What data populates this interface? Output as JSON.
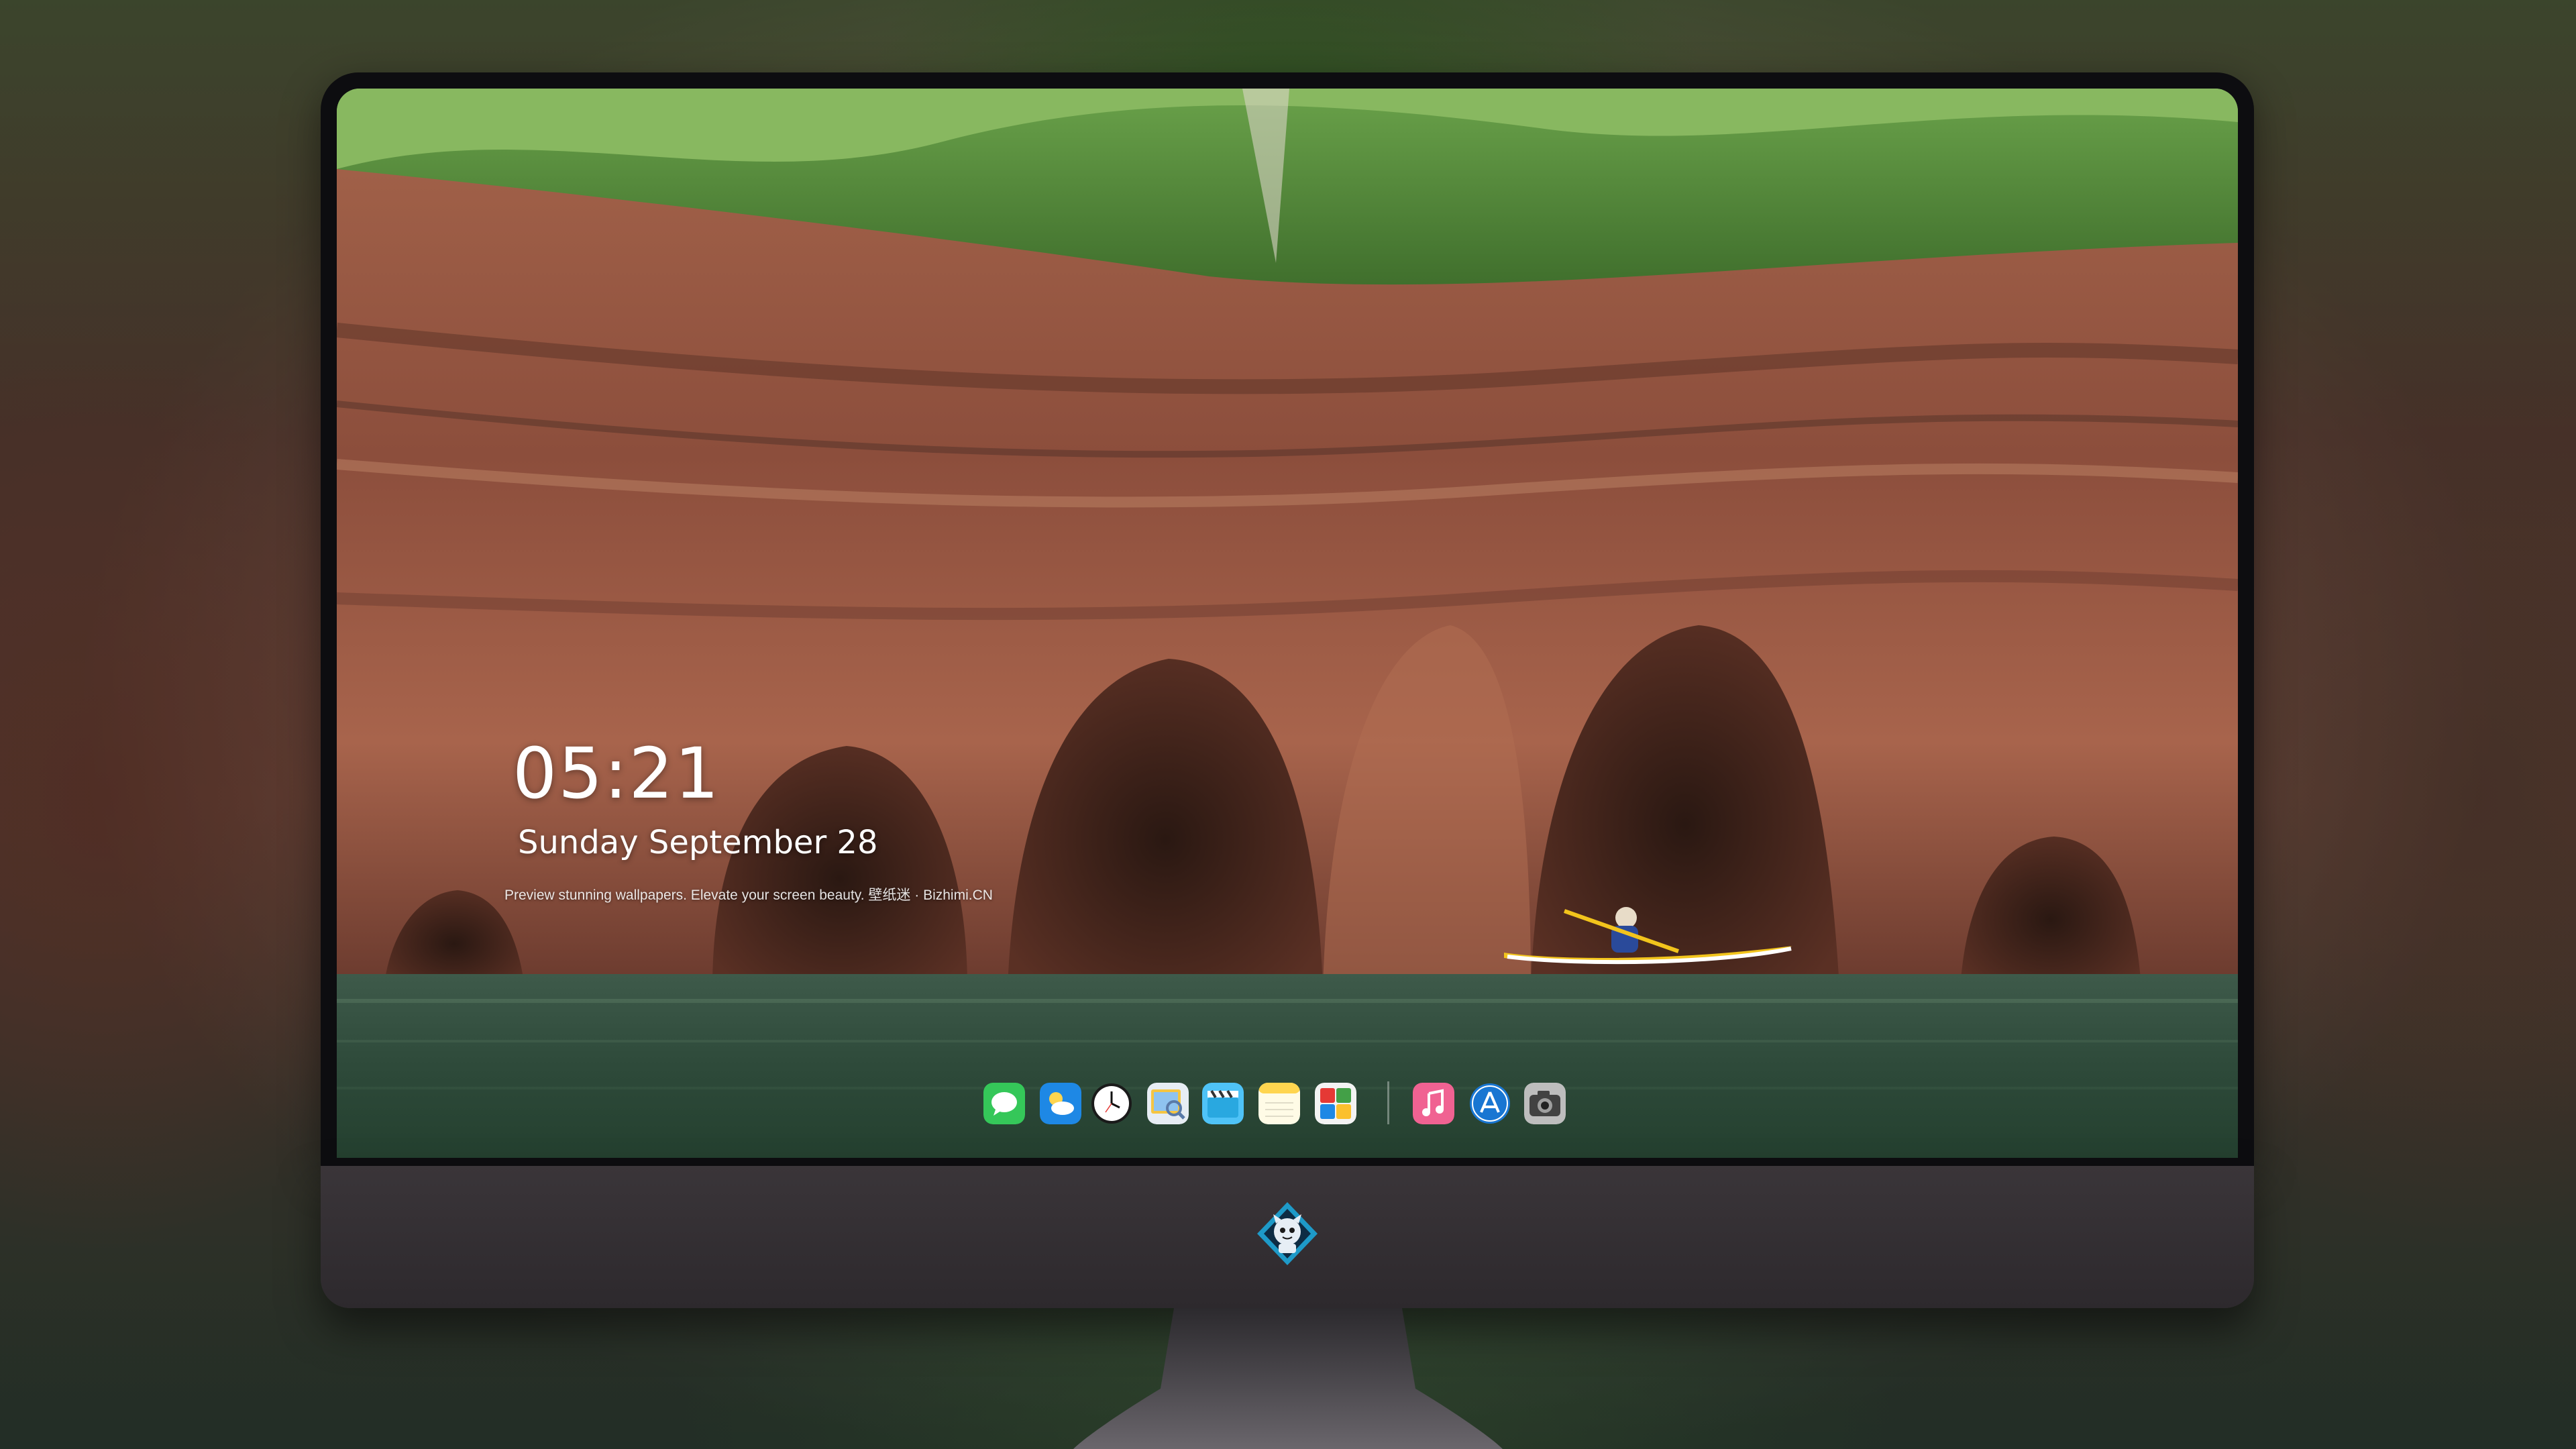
{
  "lockscreen": {
    "time": "05:21",
    "date": "Sunday September  28",
    "tagline": "Preview stunning wallpapers. Elevate your screen beauty. 壁纸迷 · Bizhimi.CN"
  },
  "dock": {
    "apps": [
      {
        "icon": "messages-icon",
        "color": "#35c759"
      },
      {
        "icon": "weather-icon",
        "color": "#1e88e5"
      },
      {
        "icon": "clock-icon",
        "color": "#ffffff"
      },
      {
        "icon": "preview-icon",
        "color": "#f5c542"
      },
      {
        "icon": "clips-icon",
        "color": "#4fc3f7"
      },
      {
        "icon": "notes-icon",
        "color": "#ffd54f"
      },
      {
        "icon": "photo-booth-icon",
        "color": "#e53935"
      },
      {
        "icon": "music-icon",
        "color": "#f06292"
      },
      {
        "icon": "app-store-icon",
        "color": "#1976d2"
      },
      {
        "icon": "camera-icon",
        "color": "#9e9e9e"
      }
    ]
  },
  "monitor": {
    "logo_icon": "bizhimi-mascot-icon"
  }
}
